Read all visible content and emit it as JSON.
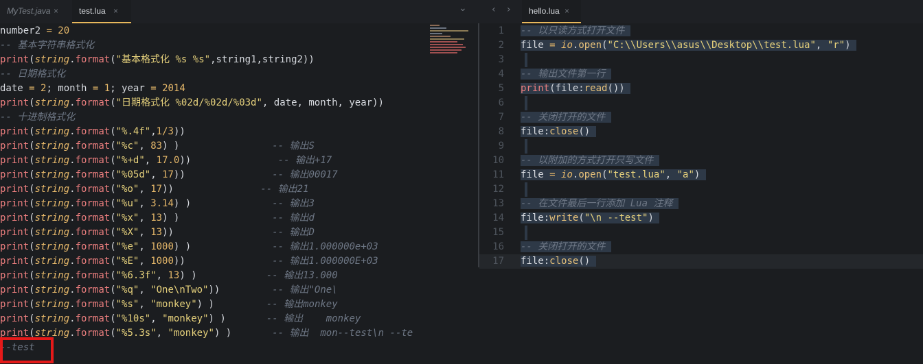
{
  "tabs_left": [
    {
      "label": "MyTest.java",
      "close": "×",
      "active": false
    },
    {
      "label": "test.lua",
      "close": "×",
      "active": true
    }
  ],
  "tabs_right": [
    {
      "label": "hello.lua",
      "close": "×",
      "active": true
    }
  ],
  "nav": {
    "back": "‹",
    "forward": "›",
    "dropdown": "⌄"
  },
  "left_code": [
    [
      [
        "id",
        "number2 "
      ],
      [
        "op",
        "= "
      ],
      [
        "num",
        "20"
      ]
    ],
    [
      [
        "cm",
        "-- 基本字符串格式化"
      ]
    ],
    [
      [
        "fn",
        "print"
      ],
      [
        "id",
        "("
      ],
      [
        "lib",
        "string"
      ],
      [
        "id",
        "."
      ],
      [
        "fn",
        "format"
      ],
      [
        "id",
        "("
      ],
      [
        "str",
        "\"基本格式化 %s %s\""
      ],
      [
        "id",
        ",string1,string2))"
      ]
    ],
    [
      [
        "cm",
        "-- 日期格式化"
      ]
    ],
    [
      [
        "id",
        "date "
      ],
      [
        "op",
        "= "
      ],
      [
        "num",
        "2"
      ],
      [
        "id",
        "; month "
      ],
      [
        "op",
        "= "
      ],
      [
        "num",
        "1"
      ],
      [
        "id",
        "; year "
      ],
      [
        "op",
        "= "
      ],
      [
        "num",
        "2014"
      ]
    ],
    [
      [
        "fn",
        "print"
      ],
      [
        "id",
        "("
      ],
      [
        "lib",
        "string"
      ],
      [
        "id",
        "."
      ],
      [
        "fn",
        "format"
      ],
      [
        "id",
        "("
      ],
      [
        "str",
        "\"日期格式化 %02d/%02d/%03d\""
      ],
      [
        "id",
        ", date, month, year))"
      ]
    ],
    [
      [
        "cm",
        "-- 十进制格式化"
      ]
    ],
    [
      [
        "fn",
        "print"
      ],
      [
        "id",
        "("
      ],
      [
        "lib",
        "string"
      ],
      [
        "id",
        "."
      ],
      [
        "fn",
        "format"
      ],
      [
        "id",
        "("
      ],
      [
        "str",
        "\"%.4f\""
      ],
      [
        "id",
        ","
      ],
      [
        "num",
        "1"
      ],
      [
        "op",
        "/"
      ],
      [
        "num",
        "3"
      ],
      [
        "id",
        "))"
      ]
    ],
    [
      [
        "fn",
        "print"
      ],
      [
        "id",
        "("
      ],
      [
        "lib",
        "string"
      ],
      [
        "id",
        "."
      ],
      [
        "fn",
        "format"
      ],
      [
        "id",
        "("
      ],
      [
        "str",
        "\"%c\""
      ],
      [
        "id",
        ", "
      ],
      [
        "num",
        "83"
      ],
      [
        "id",
        ") )                "
      ],
      [
        "cm",
        "-- 输出S"
      ]
    ],
    [
      [
        "fn",
        "print"
      ],
      [
        "id",
        "("
      ],
      [
        "lib",
        "string"
      ],
      [
        "id",
        "."
      ],
      [
        "fn",
        "format"
      ],
      [
        "id",
        "("
      ],
      [
        "str",
        "\"%+d\""
      ],
      [
        "id",
        ", "
      ],
      [
        "num",
        "17.0"
      ],
      [
        "id",
        "))               "
      ],
      [
        "cm",
        "-- 输出+17"
      ]
    ],
    [
      [
        "fn",
        "print"
      ],
      [
        "id",
        "("
      ],
      [
        "lib",
        "string"
      ],
      [
        "id",
        "."
      ],
      [
        "fn",
        "format"
      ],
      [
        "id",
        "("
      ],
      [
        "str",
        "\"%05d\""
      ],
      [
        "id",
        ", "
      ],
      [
        "num",
        "17"
      ],
      [
        "id",
        "))               "
      ],
      [
        "cm",
        "-- 输出00017"
      ]
    ],
    [
      [
        "fn",
        "print"
      ],
      [
        "id",
        "("
      ],
      [
        "lib",
        "string"
      ],
      [
        "id",
        "."
      ],
      [
        "fn",
        "format"
      ],
      [
        "id",
        "("
      ],
      [
        "str",
        "\"%o\""
      ],
      [
        "id",
        ", "
      ],
      [
        "num",
        "17"
      ],
      [
        "id",
        "))               "
      ],
      [
        "cm",
        "-- 输出21"
      ]
    ],
    [
      [
        "fn",
        "print"
      ],
      [
        "id",
        "("
      ],
      [
        "lib",
        "string"
      ],
      [
        "id",
        "."
      ],
      [
        "fn",
        "format"
      ],
      [
        "id",
        "("
      ],
      [
        "str",
        "\"%u\""
      ],
      [
        "id",
        ", "
      ],
      [
        "num",
        "3.14"
      ],
      [
        "id",
        ") )              "
      ],
      [
        "cm",
        "-- 输出3"
      ]
    ],
    [
      [
        "fn",
        "print"
      ],
      [
        "id",
        "("
      ],
      [
        "lib",
        "string"
      ],
      [
        "id",
        "."
      ],
      [
        "fn",
        "format"
      ],
      [
        "id",
        "("
      ],
      [
        "str",
        "\"%x\""
      ],
      [
        "id",
        ", "
      ],
      [
        "num",
        "13"
      ],
      [
        "id",
        ") )                "
      ],
      [
        "cm",
        "-- 输出d"
      ]
    ],
    [
      [
        "fn",
        "print"
      ],
      [
        "id",
        "("
      ],
      [
        "lib",
        "string"
      ],
      [
        "id",
        "."
      ],
      [
        "fn",
        "format"
      ],
      [
        "id",
        "("
      ],
      [
        "str",
        "\"%X\""
      ],
      [
        "id",
        ", "
      ],
      [
        "num",
        "13"
      ],
      [
        "id",
        "))                 "
      ],
      [
        "cm",
        "-- 输出D"
      ]
    ],
    [
      [
        "fn",
        "print"
      ],
      [
        "id",
        "("
      ],
      [
        "lib",
        "string"
      ],
      [
        "id",
        "."
      ],
      [
        "fn",
        "format"
      ],
      [
        "id",
        "("
      ],
      [
        "str",
        "\"%e\""
      ],
      [
        "id",
        ", "
      ],
      [
        "num",
        "1000"
      ],
      [
        "id",
        ") )              "
      ],
      [
        "cm",
        "-- 输出1.000000e+03"
      ]
    ],
    [
      [
        "fn",
        "print"
      ],
      [
        "id",
        "("
      ],
      [
        "lib",
        "string"
      ],
      [
        "id",
        "."
      ],
      [
        "fn",
        "format"
      ],
      [
        "id",
        "("
      ],
      [
        "str",
        "\"%E\""
      ],
      [
        "id",
        ", "
      ],
      [
        "num",
        "1000"
      ],
      [
        "id",
        "))               "
      ],
      [
        "cm",
        "-- 输出1.000000E+03"
      ]
    ],
    [
      [
        "fn",
        "print"
      ],
      [
        "id",
        "("
      ],
      [
        "lib",
        "string"
      ],
      [
        "id",
        "."
      ],
      [
        "fn",
        "format"
      ],
      [
        "id",
        "("
      ],
      [
        "str",
        "\"%6.3f\""
      ],
      [
        "id",
        ", "
      ],
      [
        "num",
        "13"
      ],
      [
        "id",
        ") )            "
      ],
      [
        "cm",
        "-- 输出13.000"
      ]
    ],
    [
      [
        "fn",
        "print"
      ],
      [
        "id",
        "("
      ],
      [
        "lib",
        "string"
      ],
      [
        "id",
        "."
      ],
      [
        "fn",
        "format"
      ],
      [
        "id",
        "("
      ],
      [
        "str",
        "\"%q\""
      ],
      [
        "id",
        ", "
      ],
      [
        "str",
        "\"One\\nTwo\""
      ],
      [
        "id",
        "))         "
      ],
      [
        "cm",
        "-- 输出\"One\\"
      ]
    ],
    [
      [
        "fn",
        "print"
      ],
      [
        "id",
        "("
      ],
      [
        "lib",
        "string"
      ],
      [
        "id",
        "."
      ],
      [
        "fn",
        "format"
      ],
      [
        "id",
        "("
      ],
      [
        "str",
        "\"%s\""
      ],
      [
        "id",
        ", "
      ],
      [
        "str",
        "\"monkey\""
      ],
      [
        "id",
        ") )         "
      ],
      [
        "cm",
        "-- 输出monkey"
      ]
    ],
    [
      [
        "fn",
        "print"
      ],
      [
        "id",
        "("
      ],
      [
        "lib",
        "string"
      ],
      [
        "id",
        "."
      ],
      [
        "fn",
        "format"
      ],
      [
        "id",
        "("
      ],
      [
        "str",
        "\"%10s\""
      ],
      [
        "id",
        ", "
      ],
      [
        "str",
        "\"monkey\""
      ],
      [
        "id",
        ") )       "
      ],
      [
        "cm",
        "-- 输出    monkey"
      ]
    ],
    [
      [
        "fn",
        "print"
      ],
      [
        "id",
        "("
      ],
      [
        "lib",
        "string"
      ],
      [
        "id",
        "."
      ],
      [
        "fn",
        "format"
      ],
      [
        "id",
        "("
      ],
      [
        "str",
        "\"%5.3s\""
      ],
      [
        "id",
        ", "
      ],
      [
        "str",
        "\"monkey\""
      ],
      [
        "id",
        ") )       "
      ],
      [
        "cm",
        "-- 输出  mon--test\\n --te"
      ]
    ],
    [
      [
        "cm",
        "--test"
      ]
    ]
  ],
  "right_code": [
    {
      "n": "1",
      "tokens": [
        [
          "cm",
          "-- 以只读方式打开文件"
        ]
      ]
    },
    {
      "n": "2",
      "tokens": [
        [
          "id",
          "file "
        ],
        [
          "op",
          "= "
        ],
        [
          "lib",
          "io"
        ],
        [
          "id",
          "."
        ],
        [
          "mth",
          "open"
        ],
        [
          "id",
          "("
        ],
        [
          "str",
          "\"C:\\\\Users\\\\asus\\\\Desktop\\\\test.lua\""
        ],
        [
          "id",
          ", "
        ],
        [
          "str",
          "\"r\""
        ],
        [
          "id",
          ")"
        ]
      ]
    },
    {
      "n": "3",
      "tokens": []
    },
    {
      "n": "4",
      "tokens": [
        [
          "cm",
          "-- 输出文件第一行"
        ]
      ]
    },
    {
      "n": "5",
      "tokens": [
        [
          "fn",
          "print"
        ],
        [
          "id",
          "(file:"
        ],
        [
          "mth",
          "read"
        ],
        [
          "id",
          "())"
        ]
      ]
    },
    {
      "n": "6",
      "tokens": []
    },
    {
      "n": "7",
      "tokens": [
        [
          "cm",
          "-- 关闭打开的文件"
        ]
      ]
    },
    {
      "n": "8",
      "tokens": [
        [
          "id",
          "file:"
        ],
        [
          "mth",
          "close"
        ],
        [
          "id",
          "()"
        ]
      ]
    },
    {
      "n": "9",
      "tokens": []
    },
    {
      "n": "10",
      "tokens": [
        [
          "cm",
          "-- 以附加的方式打开只写文件"
        ]
      ]
    },
    {
      "n": "11",
      "tokens": [
        [
          "id",
          "file "
        ],
        [
          "op",
          "= "
        ],
        [
          "lib",
          "io"
        ],
        [
          "id",
          "."
        ],
        [
          "mth",
          "open"
        ],
        [
          "id",
          "("
        ],
        [
          "str",
          "\"test.lua\""
        ],
        [
          "id",
          ", "
        ],
        [
          "str",
          "\"a\""
        ],
        [
          "id",
          ")"
        ]
      ]
    },
    {
      "n": "12",
      "tokens": []
    },
    {
      "n": "13",
      "tokens": [
        [
          "cm",
          "-- 在文件最后一行添加 Lua 注释"
        ]
      ]
    },
    {
      "n": "14",
      "tokens": [
        [
          "id",
          "file:"
        ],
        [
          "mth",
          "write"
        ],
        [
          "id",
          "("
        ],
        [
          "str",
          "\"\\n --test\""
        ],
        [
          "id",
          ")"
        ]
      ]
    },
    {
      "n": "15",
      "tokens": []
    },
    {
      "n": "16",
      "tokens": [
        [
          "cm",
          "-- 关闭打开的文件"
        ]
      ]
    },
    {
      "n": "17",
      "tokens": [
        [
          "id",
          "file:"
        ],
        [
          "mth",
          "close"
        ],
        [
          "id",
          "()"
        ]
      ]
    }
  ],
  "colors": {
    "accent_tab": "#e8b85c",
    "highlight_box": "#e51919"
  }
}
